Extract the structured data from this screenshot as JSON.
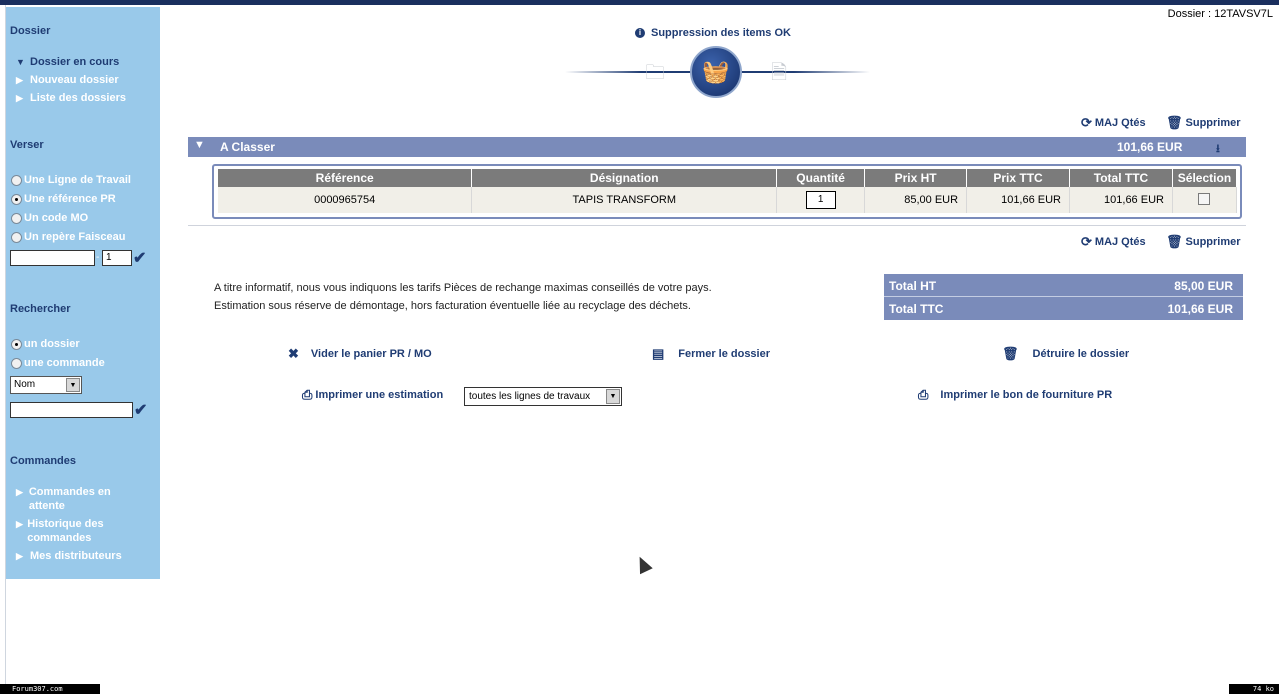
{
  "header": {
    "dossier_id": "Dossier : 12TAVSV7L"
  },
  "status": {
    "message": "Suppression des items OK"
  },
  "sidebar": {
    "dossier": {
      "heading": "Dossier",
      "items": [
        {
          "label": "Dossier en cours",
          "active": true
        },
        {
          "label": "Nouveau dossier",
          "active": false
        },
        {
          "label": "Liste des dossiers",
          "active": false
        }
      ]
    },
    "verser": {
      "heading": "Verser",
      "options": [
        {
          "label": "Une Ligne de Travail",
          "selected": false
        },
        {
          "label": "Une référence PR",
          "selected": true
        },
        {
          "label": "Un code MO",
          "selected": false
        },
        {
          "label": "Un repère Faisceau",
          "selected": false
        }
      ],
      "input_value": "",
      "qty_value": "1"
    },
    "rechercher": {
      "heading": "Rechercher",
      "options": [
        {
          "label": "un dossier",
          "selected": true
        },
        {
          "label": "une commande",
          "selected": false
        }
      ],
      "select_value": "Nom",
      "input_value": ""
    },
    "commandes": {
      "heading": "Commandes",
      "items": [
        {
          "label": "Commandes en attente"
        },
        {
          "label": "Historique des commandes"
        },
        {
          "label": "Mes distributeurs"
        }
      ]
    }
  },
  "toolbar": {
    "maj_label": "MAJ Qtés",
    "supprimer_label": "Supprimer"
  },
  "section": {
    "title": "A Classer",
    "amount": "101,66  EUR"
  },
  "table": {
    "headers": [
      "Référence",
      "Désignation",
      "Quantité",
      "Prix HT",
      "Prix TTC",
      "Total TTC",
      "Sélection"
    ],
    "rows": [
      {
        "reference": "0000965754",
        "designation": "TAPIS TRANSFORM",
        "quantite": "1",
        "prix_ht": "85,00 EUR",
        "prix_ttc": "101,66 EUR",
        "total_ttc": "101,66 EUR",
        "selected": false
      }
    ]
  },
  "info": {
    "line1": "A titre informatif, nous vous indiquons les tarifs Pièces de rechange maximas conseillés de votre pays.",
    "line2": "Estimation sous réserve de démontage, hors facturation éventuelle liée au recyclage des déchets."
  },
  "totals": {
    "ht_label": "Total HT",
    "ht_value": "85,00  EUR",
    "ttc_label": "Total TTC",
    "ttc_value": "101,66  EUR"
  },
  "actions": {
    "vider": "Vider le panier PR / MO",
    "fermer": "Fermer le dossier",
    "detruire": "Détruire le dossier",
    "imprimer_estimation": "Imprimer une estimation",
    "estimation_select": "toutes les lignes de travaux",
    "imprimer_bon": "Imprimer le bon de fourniture PR"
  },
  "footer": {
    "left": "Forum307.com",
    "right": "74 ko"
  }
}
